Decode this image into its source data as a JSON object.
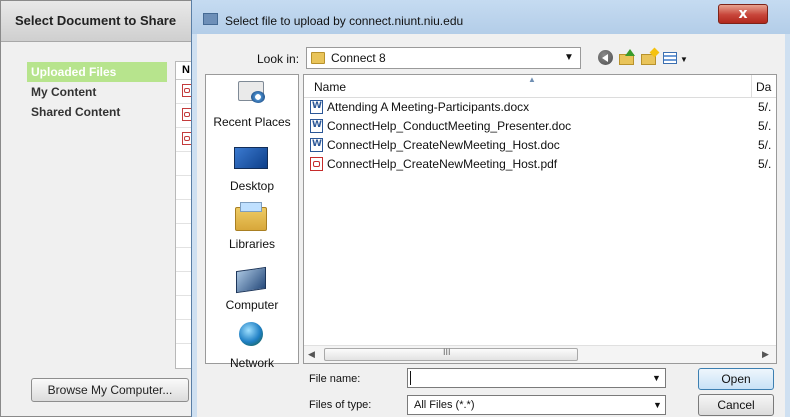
{
  "background_panel": {
    "title": "Select Document to Share",
    "nav_items": [
      {
        "label": "Uploaded Files",
        "active": true
      },
      {
        "label": "My Content",
        "active": false
      },
      {
        "label": "Shared Content",
        "active": false
      }
    ],
    "list_header": "N",
    "browse_button": "Browse My Computer..."
  },
  "dialog": {
    "title": "Select file to upload by connect.niunt.niu.edu",
    "close_label": "x",
    "look_in_label": "Look in:",
    "look_in_value": "Connect 8",
    "places": [
      {
        "label": "Recent Places",
        "icon": "recent-places-icon"
      },
      {
        "label": "Desktop",
        "icon": "desktop-icon"
      },
      {
        "label": "Libraries",
        "icon": "libraries-icon"
      },
      {
        "label": "Computer",
        "icon": "computer-icon"
      },
      {
        "label": "Network",
        "icon": "network-icon"
      }
    ],
    "columns": {
      "name": "Name",
      "date": "Da"
    },
    "files": [
      {
        "name": "Attending A Meeting-Participants.docx",
        "date": "5/.",
        "type": "doc"
      },
      {
        "name": "ConnectHelp_ConductMeeting_Presenter.doc",
        "date": "5/.",
        "type": "doc"
      },
      {
        "name": "ConnectHelp_CreateNewMeeting_Host.doc",
        "date": "5/.",
        "type": "doc"
      },
      {
        "name": "ConnectHelp_CreateNewMeeting_Host.pdf",
        "date": "5/.",
        "type": "pdf"
      }
    ],
    "scroll_grip": "III",
    "file_name_label": "File name:",
    "file_name_value": "",
    "files_of_type_label": "Files of type:",
    "files_of_type_value": "All Files (*.*)",
    "open_button": "Open",
    "cancel_button": "Cancel"
  }
}
